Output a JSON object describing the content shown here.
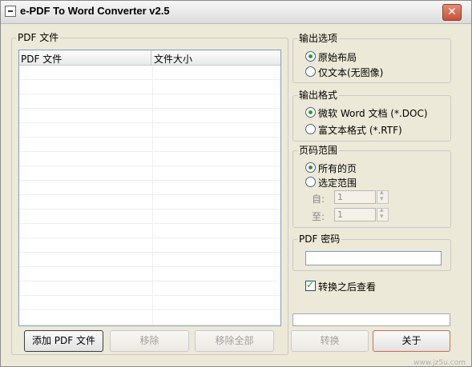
{
  "window": {
    "title": "e-PDF To Word Converter v2.5",
    "close_label": "✕"
  },
  "left_group": {
    "label": "PDF 文件",
    "columns": [
      "PDF 文件",
      "文件大小"
    ]
  },
  "buttons": {
    "add": "添加 PDF 文件",
    "remove": "移除",
    "remove_all": "移除全部",
    "convert": "转换",
    "close": "关于"
  },
  "output_options": {
    "label": "输出选项",
    "options": [
      "原始布局",
      "仅文本(无图像)"
    ],
    "selected": 0
  },
  "output_format": {
    "label": "输出格式",
    "options": [
      "微软 Word 文档 (*.DOC)",
      "富文本格式 (*.RTF)"
    ],
    "selected": 0
  },
  "page_range": {
    "label": "页码范围",
    "options": [
      "所有的页",
      "选定范围"
    ],
    "selected": 0,
    "from_label": "自:",
    "from_value": "1",
    "to_label": "至:",
    "to_value": "1"
  },
  "pdf_password": {
    "label": "PDF 密码",
    "value": ""
  },
  "view_after": {
    "label": "转换之后查看",
    "checked": true
  },
  "watermark": "www.jz5u.com"
}
